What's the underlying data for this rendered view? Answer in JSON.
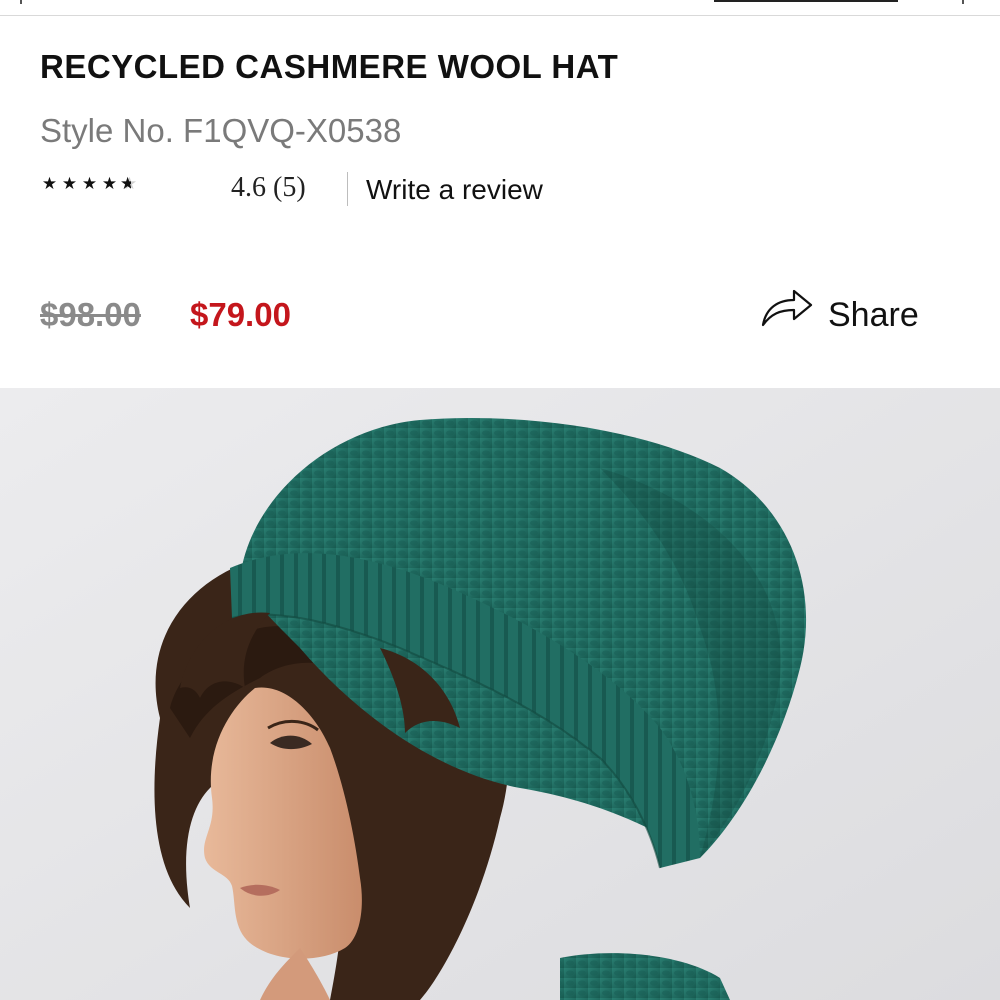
{
  "product": {
    "title": "RECYCLED CASHMERE WOOL HAT",
    "style_no": "Style No. F1QVQ-X0538",
    "rating": {
      "stars_value": 4.6,
      "stars_max": 5,
      "summary": "4.6 (5)",
      "write_review_label": "Write a review"
    },
    "price": {
      "original": "$98.00",
      "sale": "$79.00"
    },
    "share_label": "Share"
  },
  "icons": {
    "share": "share-arrow-icon",
    "star": "star-icon"
  },
  "colors": {
    "sale_price": "#c4161c",
    "original_price": "#8a8a8a",
    "hat": "#1f6e63",
    "hero_background": "#e6e6e8"
  }
}
